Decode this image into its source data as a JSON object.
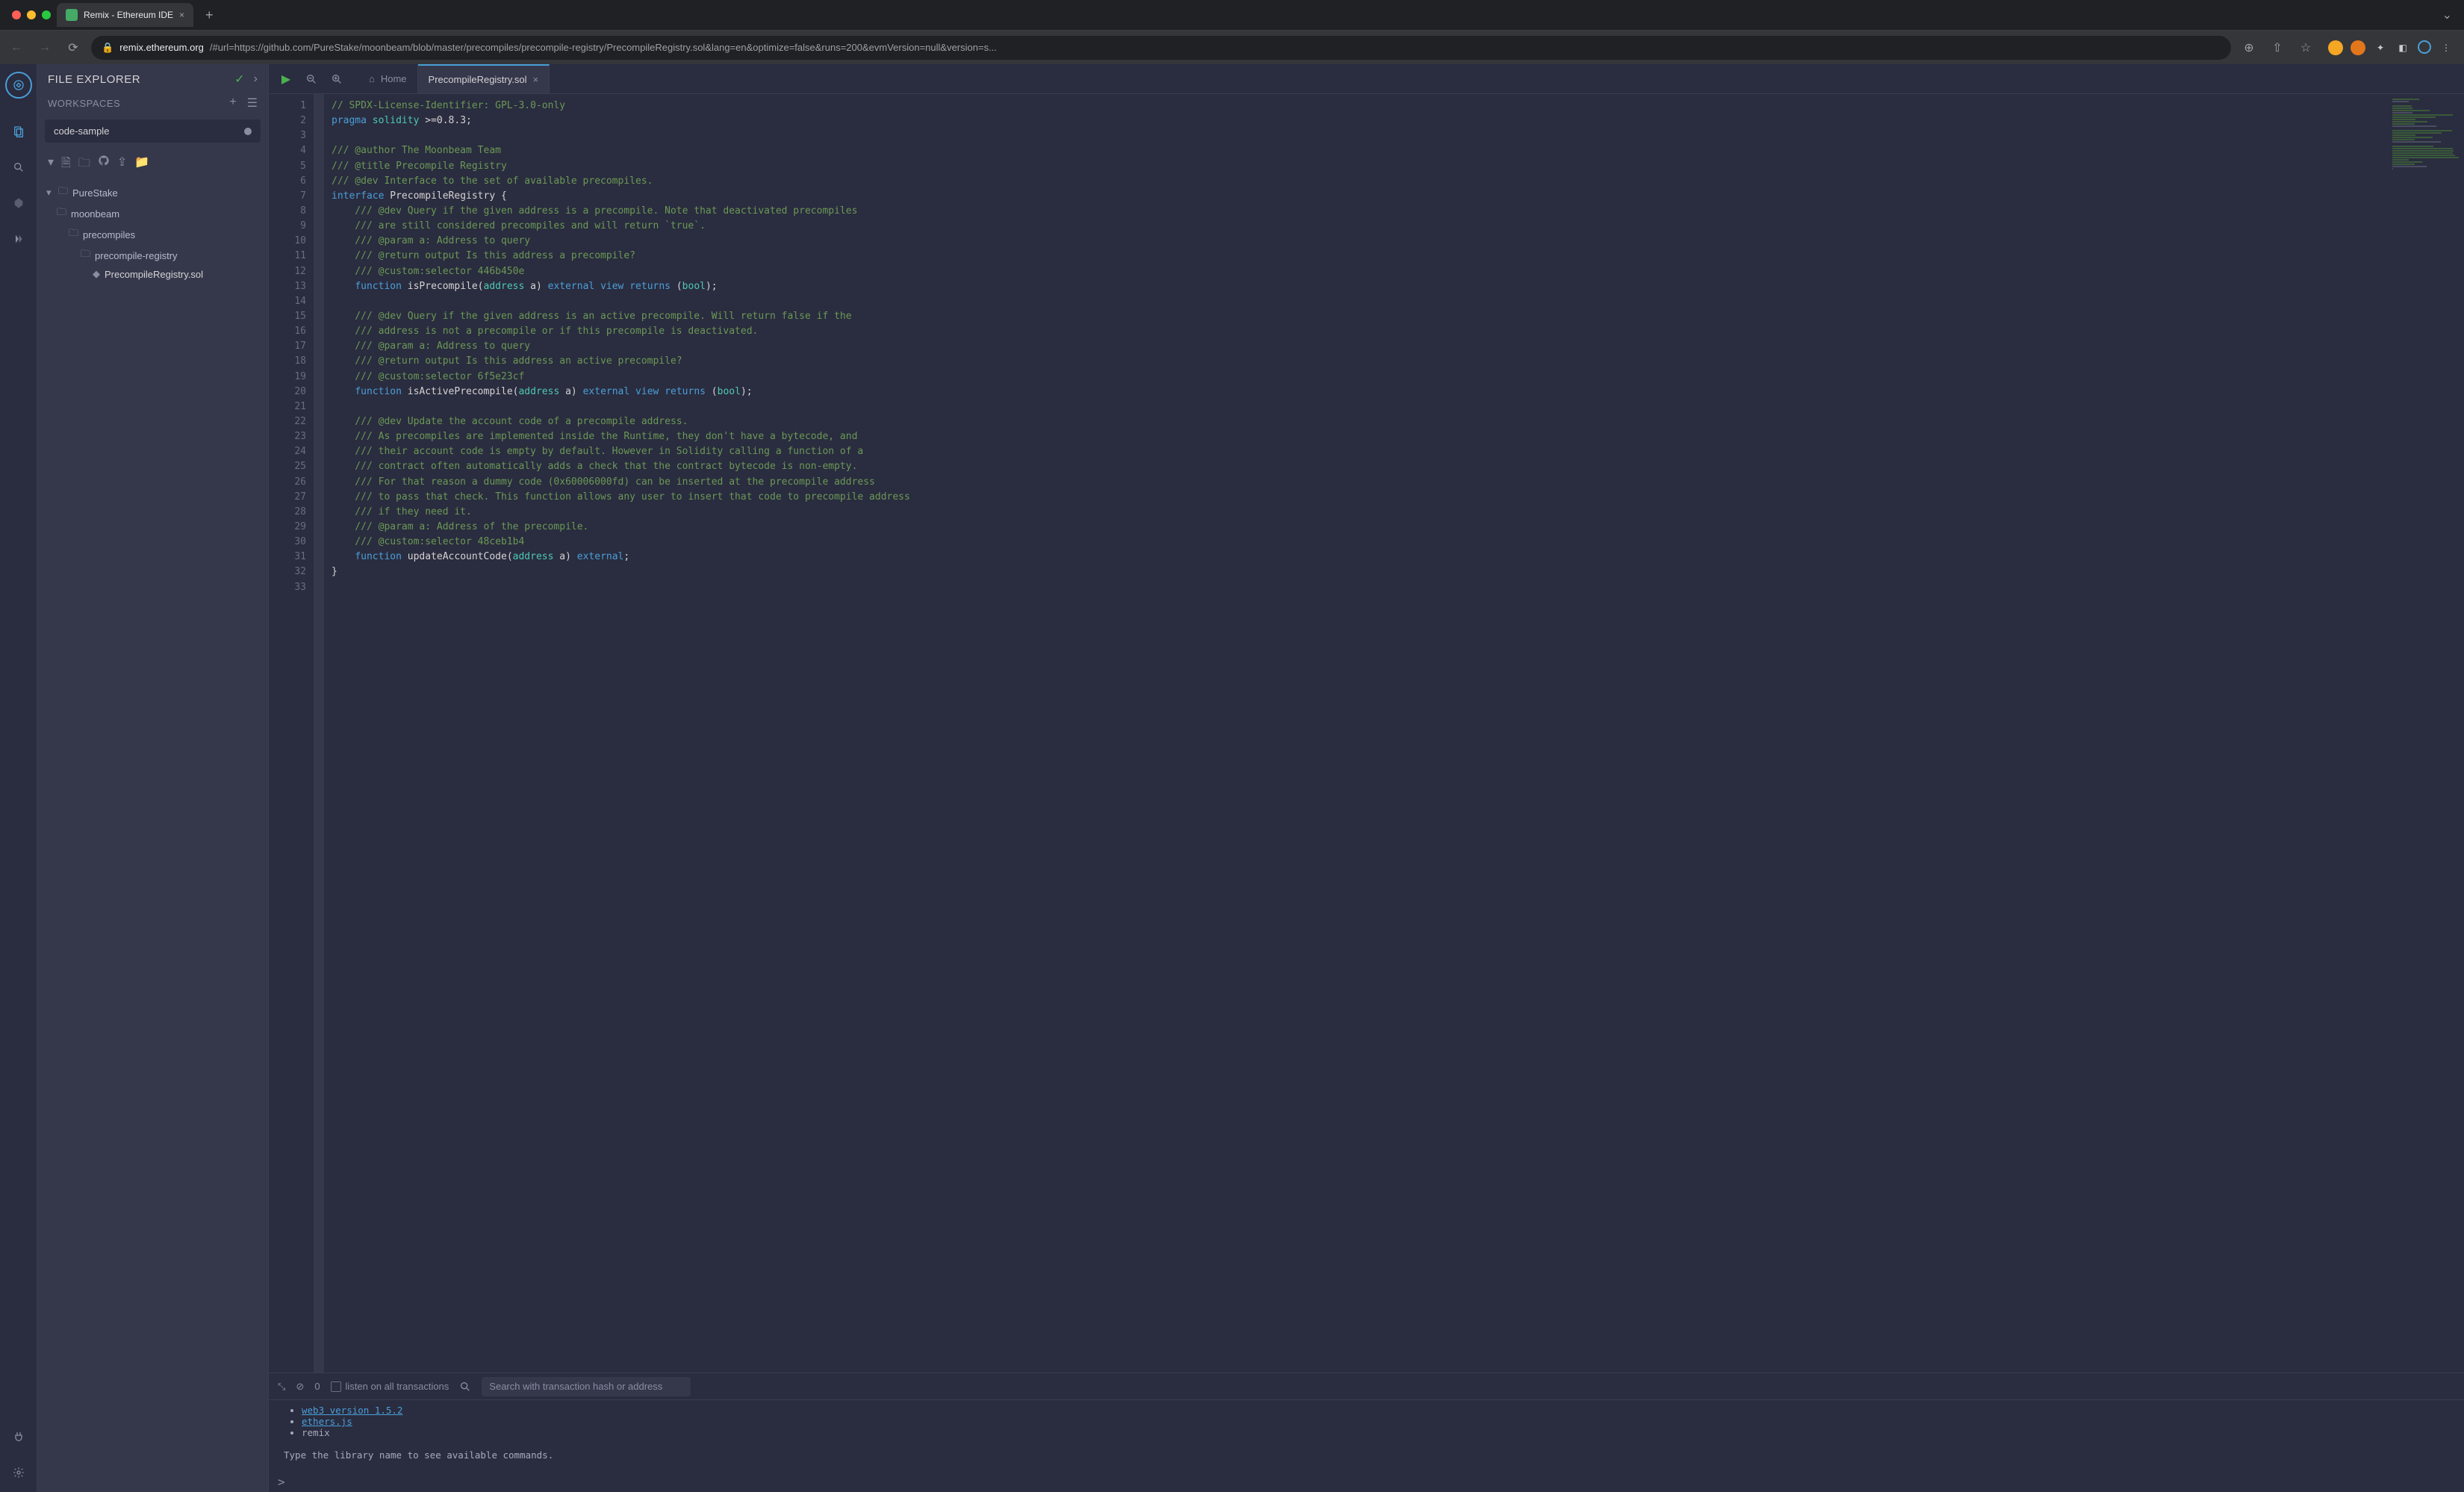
{
  "browser": {
    "tab_title": "Remix - Ethereum IDE",
    "url_domain": "remix.ethereum.org",
    "url_path": "/#url=https://github.com/PureStake/moonbeam/blob/master/precompiles/precompile-registry/PrecompileRegistry.sol&lang=en&optimize=false&runs=200&evmVersion=null&version=s..."
  },
  "sidebar": {
    "title": "FILE EXPLORER",
    "workspaces_label": "WORKSPACES",
    "workspace_selected": "code-sample",
    "tree": {
      "root": "PureStake",
      "l1": "moonbeam",
      "l2": "precompiles",
      "l3": "precompile-registry",
      "file": "PrecompileRegistry.sol"
    }
  },
  "tabs": {
    "home": "Home",
    "active": "PrecompileRegistry.sol"
  },
  "code_lines": [
    {
      "n": 1,
      "segs": [
        {
          "t": "// SPDX-License-Identifier: GPL-3.0-only",
          "c": "comment"
        }
      ]
    },
    {
      "n": 2,
      "segs": [
        {
          "t": "pragma",
          "c": "keyword"
        },
        {
          "t": " ",
          "c": ""
        },
        {
          "t": "solidity",
          "c": "type"
        },
        {
          "t": " >=0.8.3;",
          "c": ""
        }
      ]
    },
    {
      "n": 3,
      "segs": []
    },
    {
      "n": 4,
      "segs": [
        {
          "t": "/// @author The Moonbeam Team",
          "c": "comment"
        }
      ]
    },
    {
      "n": 5,
      "segs": [
        {
          "t": "/// @title Precompile Registry",
          "c": "comment"
        }
      ]
    },
    {
      "n": 6,
      "segs": [
        {
          "t": "/// @dev Interface to the set of available precompiles.",
          "c": "comment"
        }
      ]
    },
    {
      "n": 7,
      "segs": [
        {
          "t": "interface",
          "c": "keyword"
        },
        {
          "t": " PrecompileRegistry {",
          "c": ""
        }
      ]
    },
    {
      "n": 8,
      "segs": [
        {
          "t": "    /// @dev Query if the given address is a precompile. Note that deactivated precompiles",
          "c": "comment"
        }
      ]
    },
    {
      "n": 9,
      "segs": [
        {
          "t": "    /// are still considered precompiles and will return `true`.",
          "c": "comment"
        }
      ]
    },
    {
      "n": 10,
      "segs": [
        {
          "t": "    /// @param a: Address to query",
          "c": "comment"
        }
      ]
    },
    {
      "n": 11,
      "segs": [
        {
          "t": "    /// @return output Is this address a precompile?",
          "c": "comment"
        }
      ]
    },
    {
      "n": 12,
      "segs": [
        {
          "t": "    /// @custom:selector 446b450e",
          "c": "comment"
        }
      ]
    },
    {
      "n": 13,
      "segs": [
        {
          "t": "    ",
          "c": ""
        },
        {
          "t": "function",
          "c": "keyword"
        },
        {
          "t": " isPrecompile(",
          "c": ""
        },
        {
          "t": "address",
          "c": "type"
        },
        {
          "t": " a) ",
          "c": ""
        },
        {
          "t": "external",
          "c": "keyword"
        },
        {
          "t": " ",
          "c": ""
        },
        {
          "t": "view",
          "c": "keyword"
        },
        {
          "t": " ",
          "c": ""
        },
        {
          "t": "returns",
          "c": "keyword"
        },
        {
          "t": " (",
          "c": ""
        },
        {
          "t": "bool",
          "c": "type"
        },
        {
          "t": ");",
          "c": ""
        }
      ]
    },
    {
      "n": 14,
      "segs": []
    },
    {
      "n": 15,
      "segs": [
        {
          "t": "    /// @dev Query if the given address is an active precompile. Will return false if the",
          "c": "comment"
        }
      ]
    },
    {
      "n": 16,
      "segs": [
        {
          "t": "    /// address is not a precompile or if this precompile is deactivated.",
          "c": "comment"
        }
      ]
    },
    {
      "n": 17,
      "segs": [
        {
          "t": "    /// @param a: Address to query",
          "c": "comment"
        }
      ]
    },
    {
      "n": 18,
      "segs": [
        {
          "t": "    /// @return output Is this address an active precompile?",
          "c": "comment"
        }
      ]
    },
    {
      "n": 19,
      "segs": [
        {
          "t": "    /// @custom:selector 6f5e23cf",
          "c": "comment"
        }
      ]
    },
    {
      "n": 20,
      "segs": [
        {
          "t": "    ",
          "c": ""
        },
        {
          "t": "function",
          "c": "keyword"
        },
        {
          "t": " isActivePrecompile(",
          "c": ""
        },
        {
          "t": "address",
          "c": "type"
        },
        {
          "t": " a) ",
          "c": ""
        },
        {
          "t": "external",
          "c": "keyword"
        },
        {
          "t": " ",
          "c": ""
        },
        {
          "t": "view",
          "c": "keyword"
        },
        {
          "t": " ",
          "c": ""
        },
        {
          "t": "returns",
          "c": "keyword"
        },
        {
          "t": " (",
          "c": ""
        },
        {
          "t": "bool",
          "c": "type"
        },
        {
          "t": ");",
          "c": ""
        }
      ]
    },
    {
      "n": 21,
      "segs": []
    },
    {
      "n": 22,
      "segs": [
        {
          "t": "    /// @dev Update the account code of a precompile address.",
          "c": "comment"
        }
      ]
    },
    {
      "n": 23,
      "segs": [
        {
          "t": "    /// As precompiles are implemented inside the Runtime, they don't have a bytecode, and",
          "c": "comment"
        }
      ]
    },
    {
      "n": 24,
      "segs": [
        {
          "t": "    /// their account code is empty by default. However in Solidity calling a function of a",
          "c": "comment"
        }
      ]
    },
    {
      "n": 25,
      "segs": [
        {
          "t": "    /// contract often automatically adds a check that the contract bytecode is non-empty.",
          "c": "comment"
        }
      ]
    },
    {
      "n": 26,
      "segs": [
        {
          "t": "    /// For that reason a dummy code (0x60006000fd) can be inserted at the precompile address",
          "c": "comment"
        }
      ]
    },
    {
      "n": 27,
      "segs": [
        {
          "t": "    /// to pass that check. This function allows any user to insert that code to precompile address",
          "c": "comment"
        }
      ]
    },
    {
      "n": 28,
      "segs": [
        {
          "t": "    /// if they need it.",
          "c": "comment"
        }
      ]
    },
    {
      "n": 29,
      "segs": [
        {
          "t": "    /// @param a: Address of the precompile.",
          "c": "comment"
        }
      ]
    },
    {
      "n": 30,
      "segs": [
        {
          "t": "    /// @custom:selector 48ceb1b4",
          "c": "comment"
        }
      ]
    },
    {
      "n": 31,
      "segs": [
        {
          "t": "    ",
          "c": ""
        },
        {
          "t": "function",
          "c": "keyword"
        },
        {
          "t": " updateAccountCode(",
          "c": ""
        },
        {
          "t": "address",
          "c": "type"
        },
        {
          "t": " a) ",
          "c": ""
        },
        {
          "t": "external",
          "c": "keyword"
        },
        {
          "t": ";",
          "c": ""
        }
      ]
    },
    {
      "n": 32,
      "segs": [
        {
          "t": "}",
          "c": ""
        }
      ]
    },
    {
      "n": 33,
      "segs": []
    }
  ],
  "terminal": {
    "listen_label": "listen on all transactions",
    "pending_count": "0",
    "search_placeholder": "Search with transaction hash or address",
    "lines": {
      "web3": "web3 version 1.5.2",
      "ethers": "ethers.js",
      "remix": "remix",
      "hint": "Type the library name to see available commands."
    },
    "prompt": ">"
  }
}
